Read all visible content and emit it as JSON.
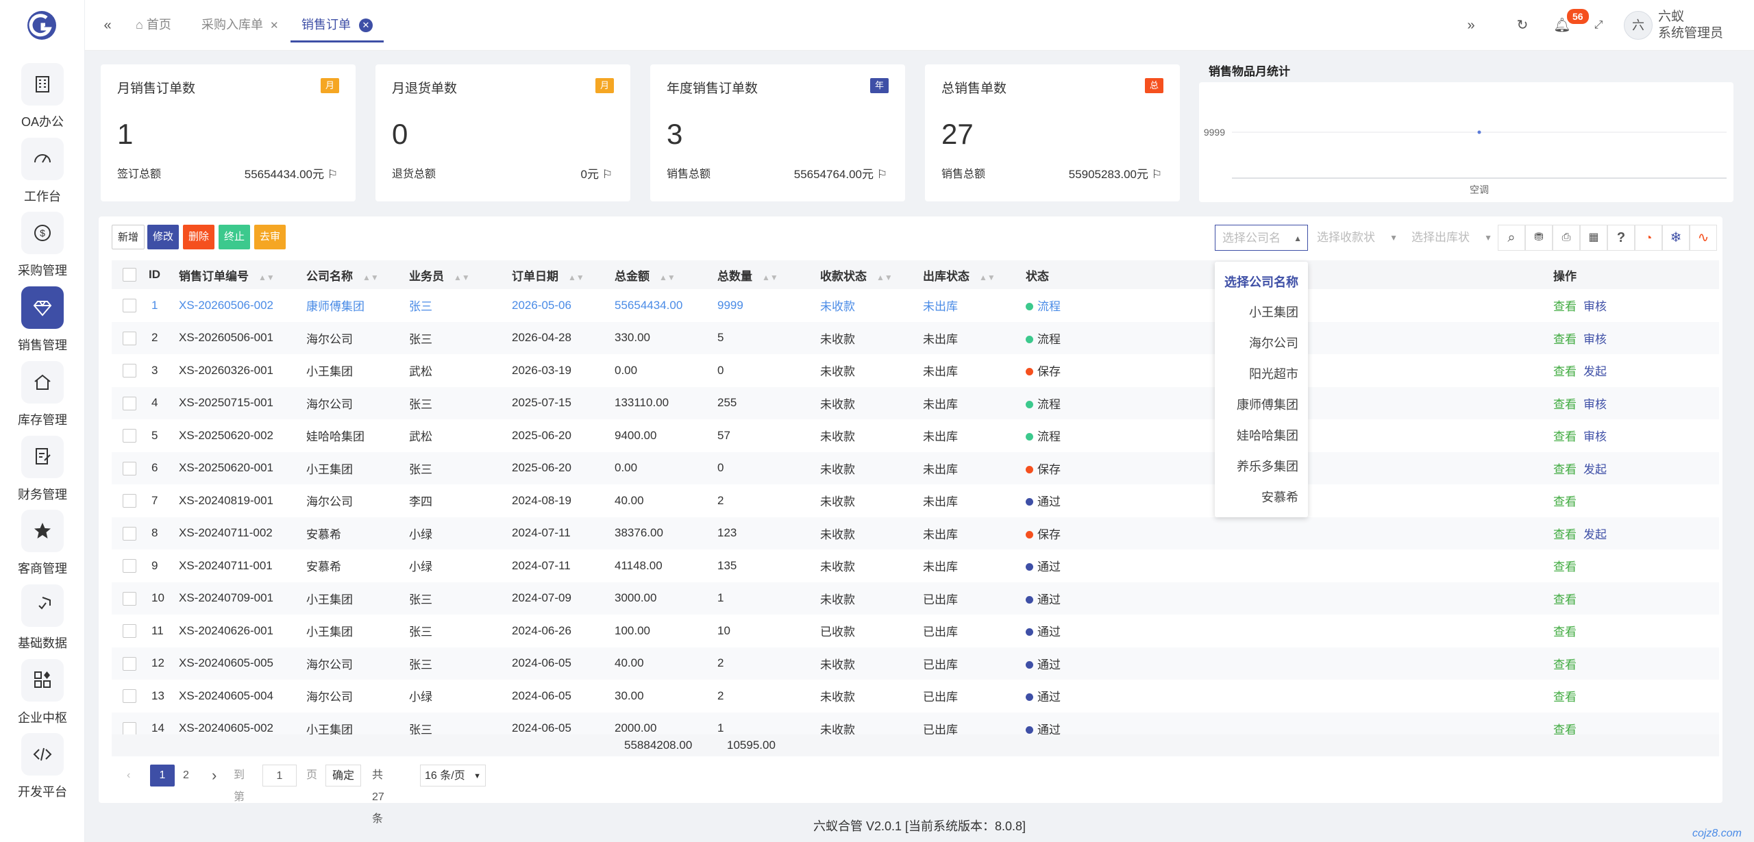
{
  "sidebar": {
    "items": [
      {
        "label": "OA办公",
        "icon": "building-icon"
      },
      {
        "label": "工作台",
        "icon": "dashboard-icon"
      },
      {
        "label": "采购管理",
        "icon": "dollar-icon"
      },
      {
        "label": "销售管理",
        "icon": "diamond-icon",
        "active": true
      },
      {
        "label": "库存管理",
        "icon": "home-icon"
      },
      {
        "label": "财务管理",
        "icon": "finance-icon"
      },
      {
        "label": "客商管理",
        "icon": "star-icon"
      },
      {
        "label": "基础数据",
        "icon": "shield-icon"
      },
      {
        "label": "企业中枢",
        "icon": "apps-icon"
      },
      {
        "label": "开发平台",
        "icon": "code-icon"
      }
    ]
  },
  "tabs": [
    {
      "label": "首页"
    },
    {
      "label": "采购入库单"
    },
    {
      "label": "销售订单"
    }
  ],
  "header": {
    "badge": "56",
    "avatar": "六",
    "user_line1": "六蚁",
    "user_line2": "系统管理员"
  },
  "cards": [
    {
      "title": "月销售订单数",
      "tag": "月",
      "tag_color": "#f5a623",
      "value": "1",
      "sub_label": "签订总额",
      "sub_value": "55654434.00元"
    },
    {
      "title": "月退货单数",
      "tag": "月",
      "tag_color": "#f5a623",
      "value": "0",
      "sub_label": "退货总额",
      "sub_value": "0元"
    },
    {
      "title": "年度销售订单数",
      "tag": "年",
      "tag_color": "#3e4fa6",
      "value": "3",
      "sub_label": "销售总额",
      "sub_value": "55654764.00元"
    },
    {
      "title": "总销售单数",
      "tag": "总",
      "tag_color": "#f5501e",
      "value": "27",
      "sub_label": "销售总额",
      "sub_value": "55905283.00元"
    }
  ],
  "chart_data": {
    "type": "line",
    "title": "销售物品月统计",
    "categories": [
      "空调"
    ],
    "series": [
      {
        "values": [
          9999
        ]
      }
    ],
    "yticks": [
      "9999"
    ],
    "grid": true
  },
  "toolbar": {
    "add": "新增",
    "edit": "修改",
    "delete": "删除",
    "stop": "终止",
    "unaudit": "去审"
  },
  "filters": {
    "company": "选择公司名",
    "payment": "选择收款状",
    "outbound": "选择出库状"
  },
  "table": {
    "headers": {
      "id": "ID",
      "code": "销售订单编号",
      "company": "公司名称",
      "staff": "业务员",
      "date": "订单日期",
      "amount": "总金额",
      "qty": "总数量",
      "pay": "收款状态",
      "out": "出库状态",
      "status": "状态",
      "ops": "操作"
    },
    "rows": [
      {
        "id": "1",
        "code": "XS-20260506-002",
        "company": "康师傅集团",
        "staff": "张三",
        "date": "2026-05-06",
        "amount": "55654434.00",
        "qty": "9999",
        "pay": "未收款",
        "out": "未出库",
        "status": "流程",
        "status_color": "#3cc98d",
        "op1": "查看",
        "op2": "审核"
      },
      {
        "id": "2",
        "code": "XS-20260506-001",
        "company": "海尔公司",
        "staff": "张三",
        "date": "2026-04-28",
        "amount": "330.00",
        "qty": "5",
        "pay": "未收款",
        "out": "未出库",
        "status": "流程",
        "status_color": "#3cc98d",
        "op1": "查看",
        "op2": "审核"
      },
      {
        "id": "3",
        "code": "XS-20260326-001",
        "company": "小王集团",
        "staff": "武松",
        "date": "2026-03-19",
        "amount": "0.00",
        "qty": "0",
        "pay": "未收款",
        "out": "未出库",
        "status": "保存",
        "status_color": "#f5501e",
        "op1": "查看",
        "op2": "发起"
      },
      {
        "id": "4",
        "code": "XS-20250715-001",
        "company": "海尔公司",
        "staff": "张三",
        "date": "2025-07-15",
        "amount": "133110.00",
        "qty": "255",
        "pay": "未收款",
        "out": "未出库",
        "status": "流程",
        "status_color": "#3cc98d",
        "op1": "查看",
        "op2": "审核"
      },
      {
        "id": "5",
        "code": "XS-20250620-002",
        "company": "娃哈哈集团",
        "staff": "武松",
        "date": "2025-06-20",
        "amount": "9400.00",
        "qty": "57",
        "pay": "未收款",
        "out": "未出库",
        "status": "流程",
        "status_color": "#3cc98d",
        "op1": "查看",
        "op2": "审核"
      },
      {
        "id": "6",
        "code": "XS-20250620-001",
        "company": "小王集团",
        "staff": "张三",
        "date": "2025-06-20",
        "amount": "0.00",
        "qty": "0",
        "pay": "未收款",
        "out": "未出库",
        "status": "保存",
        "status_color": "#f5501e",
        "op1": "查看",
        "op2": "发起"
      },
      {
        "id": "7",
        "code": "XS-20240819-001",
        "company": "海尔公司",
        "staff": "李四",
        "date": "2024-08-19",
        "amount": "40.00",
        "qty": "2",
        "pay": "未收款",
        "out": "未出库",
        "status": "通过",
        "status_color": "#3e4fa6",
        "op1": "查看",
        "op2": ""
      },
      {
        "id": "8",
        "code": "XS-20240711-002",
        "company": "安慕希",
        "staff": "小绿",
        "date": "2024-07-11",
        "amount": "38376.00",
        "qty": "123",
        "pay": "未收款",
        "out": "未出库",
        "status": "保存",
        "status_color": "#f5501e",
        "op1": "查看",
        "op2": "发起"
      },
      {
        "id": "9",
        "code": "XS-20240711-001",
        "company": "安慕希",
        "staff": "小绿",
        "date": "2024-07-11",
        "amount": "41148.00",
        "qty": "135",
        "pay": "未收款",
        "out": "未出库",
        "status": "通过",
        "status_color": "#3e4fa6",
        "op1": "查看",
        "op2": ""
      },
      {
        "id": "10",
        "code": "XS-20240709-001",
        "company": "小王集团",
        "staff": "张三",
        "date": "2024-07-09",
        "amount": "3000.00",
        "qty": "1",
        "pay": "未收款",
        "out": "已出库",
        "status": "通过",
        "status_color": "#3e4fa6",
        "op1": "查看",
        "op2": ""
      },
      {
        "id": "11",
        "code": "XS-20240626-001",
        "company": "小王集团",
        "staff": "张三",
        "date": "2024-06-26",
        "amount": "100.00",
        "qty": "10",
        "pay": "已收款",
        "out": "已出库",
        "status": "通过",
        "status_color": "#3e4fa6",
        "op1": "查看",
        "op2": ""
      },
      {
        "id": "12",
        "code": "XS-20240605-005",
        "company": "海尔公司",
        "staff": "张三",
        "date": "2024-06-05",
        "amount": "40.00",
        "qty": "2",
        "pay": "未收款",
        "out": "已出库",
        "status": "通过",
        "status_color": "#3e4fa6",
        "op1": "查看",
        "op2": ""
      },
      {
        "id": "13",
        "code": "XS-20240605-004",
        "company": "海尔公司",
        "staff": "小绿",
        "date": "2024-06-05",
        "amount": "30.00",
        "qty": "2",
        "pay": "未收款",
        "out": "已出库",
        "status": "通过",
        "status_color": "#3e4fa6",
        "op1": "查看",
        "op2": ""
      },
      {
        "id": "14",
        "code": "XS-20240605-002",
        "company": "小王集团",
        "staff": "张三",
        "date": "2024-06-05",
        "amount": "2000.00",
        "qty": "1",
        "pay": "未收款",
        "out": "已出库",
        "status": "通过",
        "status_color": "#3e4fa6",
        "op1": "查看",
        "op2": ""
      }
    ],
    "sum_amount": "55884208.00",
    "sum_qty": "10595.00"
  },
  "pager": {
    "page1": "1",
    "page2": "2",
    "goto": "到第",
    "page_input": "1",
    "page_unit": "页",
    "confirm": "确定",
    "total": "共 27 条",
    "size": "16 条/页"
  },
  "dropdown": {
    "header": "选择公司名称",
    "options": [
      "小王集团",
      "海尔公司",
      "阳光超市",
      "康师傅集团",
      "娃哈哈集团",
      "养乐多集团",
      "安慕希"
    ]
  },
  "footer": "六蚁合管 V2.0.1 [当前系统版本：8.0.8]",
  "watermark": "cojz8.com"
}
